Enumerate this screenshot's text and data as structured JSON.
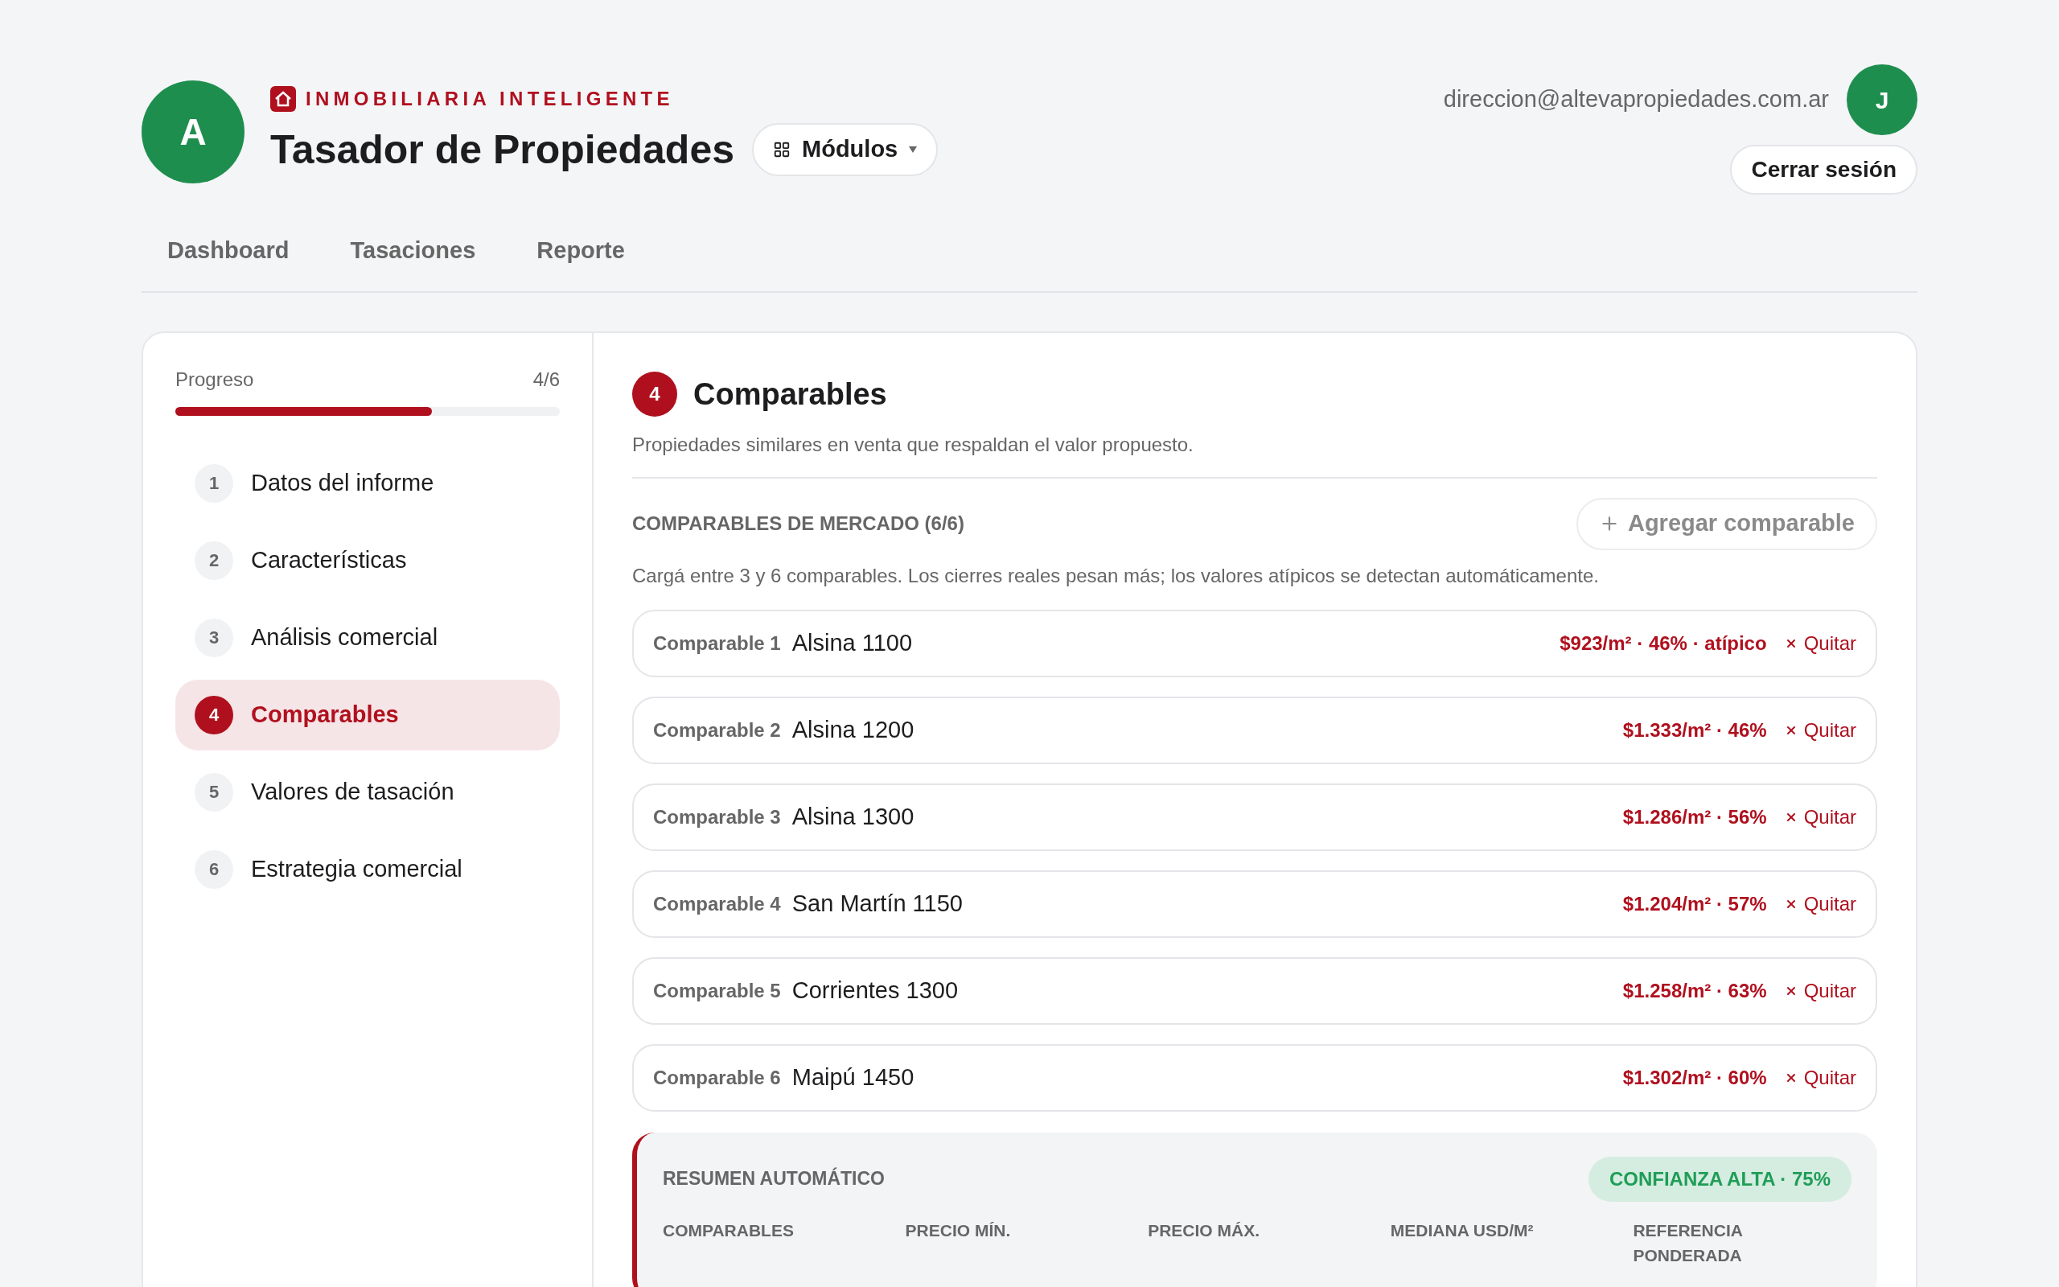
{
  "header": {
    "avatar": "A",
    "brand": "INMOBILIARIA INTELIGENTE",
    "title": "Tasador de Propiedades",
    "modules_button": "Módulos",
    "user_email": "direccion@altevapropiedades.com.ar",
    "user_avatar": "J",
    "logout_button": "Cerrar sesión"
  },
  "nav_tabs": [
    "Dashboard",
    "Tasaciones",
    "Reporte"
  ],
  "sidebar": {
    "progress_label": "Progreso",
    "progress_count": "4/6",
    "progress": {
      "level": 0.667
    },
    "steps": [
      {
        "number": "1",
        "label": "Datos del informe",
        "selected": false
      },
      {
        "number": "2",
        "label": "Características",
        "selected": false
      },
      {
        "number": "3",
        "label": "Análisis comercial",
        "selected": false
      },
      {
        "number": "4",
        "label": "Comparables",
        "selected": true
      },
      {
        "number": "5",
        "label": "Valores de tasación",
        "selected": false
      },
      {
        "number": "6",
        "label": "Estrategia comercial",
        "selected": false
      }
    ]
  },
  "section": {
    "number": "4",
    "title": "Comparables",
    "subtitle": "Propiedades similares en venta que respaldan el valor propuesto.",
    "list_title": "COMPARABLES DE MERCADO (6/6)",
    "add_button": "Agregar comparable",
    "hint": "Cargá entre 3 y 6 comparables. Los cierres reales pesan más; los valores atípicos se detectan automáticamente.",
    "comparables": [
      {
        "label": "Comparable 1",
        "address": "Alsina 1100",
        "metrics": "$923/m² · 46% · atípico",
        "remove": "Quitar"
      },
      {
        "label": "Comparable 2",
        "address": "Alsina 1200",
        "metrics": "$1.333/m² · 46%",
        "remove": "Quitar"
      },
      {
        "label": "Comparable 3",
        "address": "Alsina 1300",
        "metrics": "$1.286/m² · 56%",
        "remove": "Quitar"
      },
      {
        "label": "Comparable 4",
        "address": "San Martín 1150",
        "metrics": "$1.204/m² · 57%",
        "remove": "Quitar"
      },
      {
        "label": "Comparable 5",
        "address": "Corrientes 1300",
        "metrics": "$1.258/m² · 63%",
        "remove": "Quitar"
      },
      {
        "label": "Comparable 6",
        "address": "Maipú 1450",
        "metrics": "$1.302/m² · 60%",
        "remove": "Quitar"
      }
    ],
    "summary": {
      "title": "RESUMEN AUTOMÁTICO",
      "confidence": "CONFIANZA ALTA · 75%",
      "columns": [
        "COMPARABLES",
        "PRECIO MÍN.",
        "PRECIO MÁX.",
        "MEDIANA USD/M²",
        "REFERENCIA PONDERADA"
      ]
    }
  }
}
